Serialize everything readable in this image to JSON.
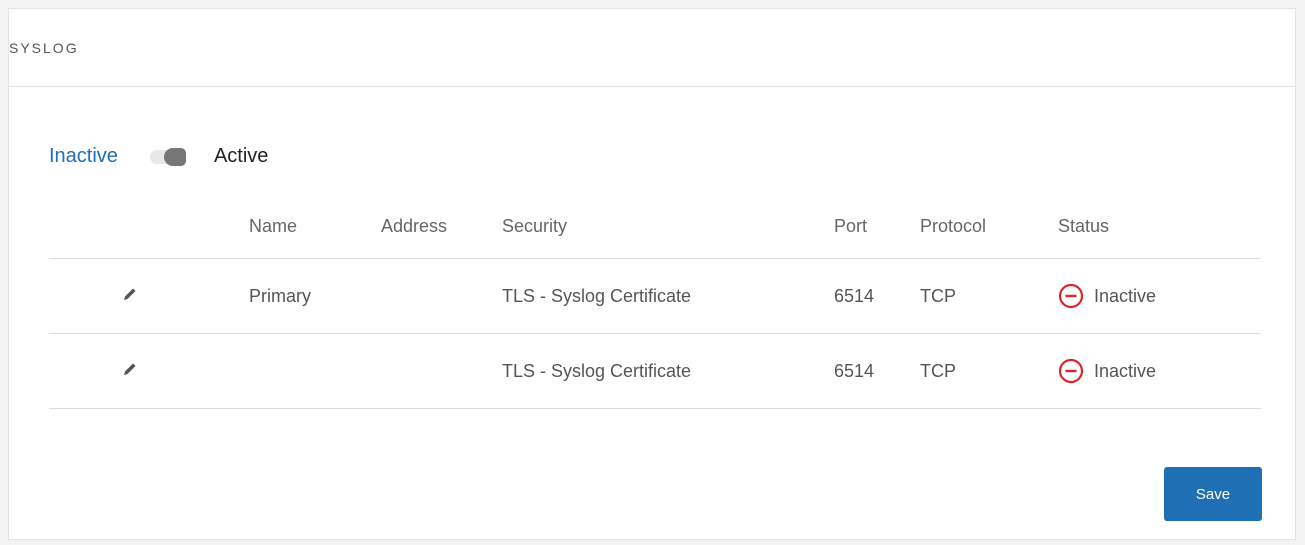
{
  "section": {
    "title": "SYSLOG"
  },
  "toggle": {
    "inactive_label": "Inactive",
    "active_label": "Active",
    "state": "inactive"
  },
  "table": {
    "columns": [
      "Name",
      "Address",
      "Security",
      "Port",
      "Protocol",
      "Status"
    ],
    "rows": [
      {
        "name": "Primary",
        "address": "",
        "security": "TLS - Syslog Certificate",
        "port": "6514",
        "protocol": "TCP",
        "status": "Inactive"
      },
      {
        "name": "",
        "address": "",
        "security": "TLS - Syslog Certificate",
        "port": "6514",
        "protocol": "TCP",
        "status": "Inactive"
      }
    ]
  },
  "icons": {
    "edit": "pencil-icon",
    "status": "minus-circle-icon"
  },
  "colors": {
    "accent": "#1f6fb4",
    "status_inactive": "#d9262c"
  },
  "actions": {
    "save_label": "Save"
  }
}
